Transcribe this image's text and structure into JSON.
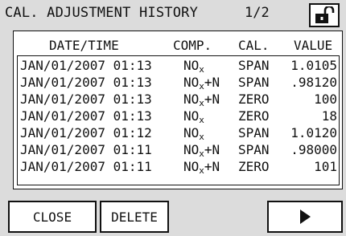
{
  "header": {
    "title": "CAL. ADJUSTMENT HISTORY",
    "page": "1/2",
    "lock_icon": "unlocked-padlock-icon"
  },
  "table": {
    "columns": {
      "datetime": "DATE/TIME",
      "comp": "COMP.",
      "cal": "CAL.",
      "value": "VALUE"
    },
    "rows": [
      {
        "datetime": "JAN/01/2007 01:13",
        "comp_base": "NO",
        "comp_sub": "x",
        "comp_suffix": "",
        "cal": "SPAN",
        "value": "1.0105"
      },
      {
        "datetime": "JAN/01/2007 01:13",
        "comp_base": "NO",
        "comp_sub": "x",
        "comp_suffix": "+N",
        "cal": "SPAN",
        "value": ".98120"
      },
      {
        "datetime": "JAN/01/2007 01:13",
        "comp_base": "NO",
        "comp_sub": "x",
        "comp_suffix": "+N",
        "cal": "ZERO",
        "value": "100"
      },
      {
        "datetime": "JAN/01/2007 01:13",
        "comp_base": "NO",
        "comp_sub": "x",
        "comp_suffix": "",
        "cal": "ZERO",
        "value": "18"
      },
      {
        "datetime": "JAN/01/2007 01:12",
        "comp_base": "NO",
        "comp_sub": "x",
        "comp_suffix": "",
        "cal": "SPAN",
        "value": "1.0120"
      },
      {
        "datetime": "JAN/01/2007 01:11",
        "comp_base": "NO",
        "comp_sub": "x",
        "comp_suffix": "+N",
        "cal": "SPAN",
        "value": ".98000"
      },
      {
        "datetime": "JAN/01/2007 01:11",
        "comp_base": "NO",
        "comp_sub": "x",
        "comp_suffix": "+N",
        "cal": "ZERO",
        "value": "101"
      }
    ]
  },
  "buttons": {
    "close": "CLOSE",
    "delete": "DELETE",
    "next_icon": "play-right-arrow-icon"
  }
}
